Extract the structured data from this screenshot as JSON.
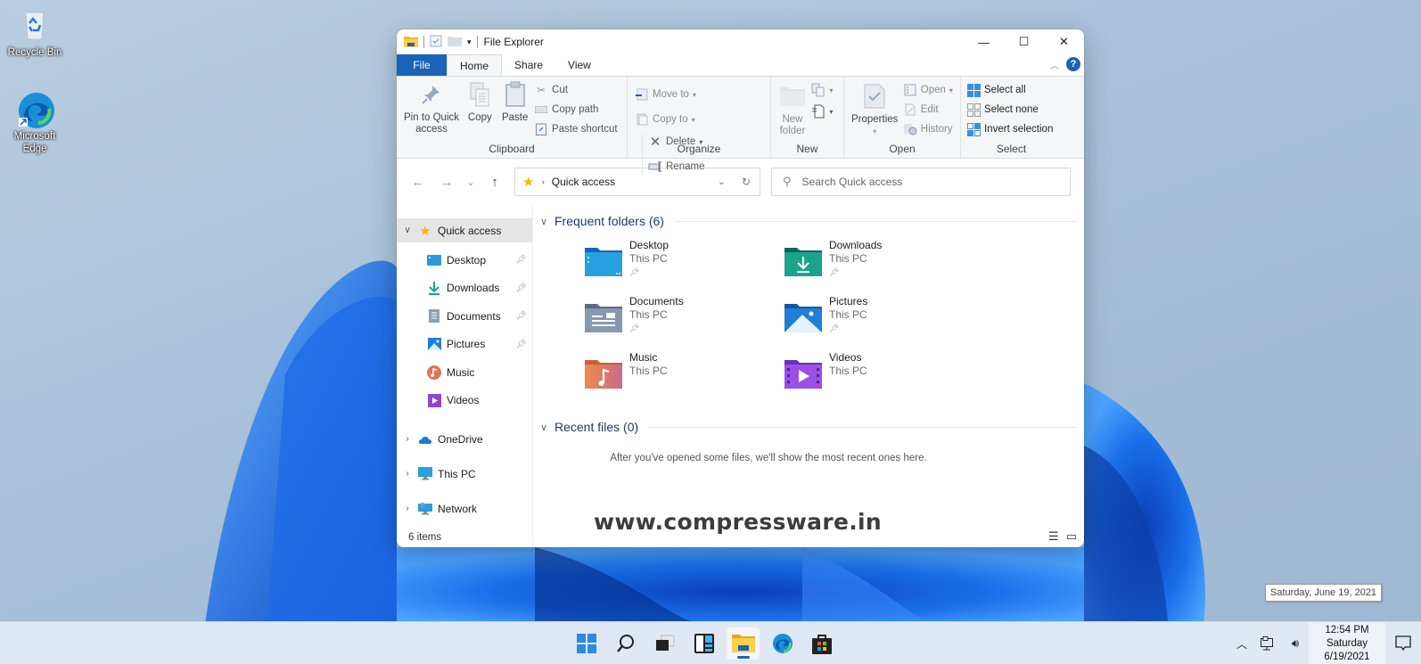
{
  "desktop": {
    "icons": [
      {
        "label": "Recycle Bin",
        "icon": "recycle-bin-icon"
      },
      {
        "label": "Microsoft Edge",
        "icon": "edge-icon"
      }
    ]
  },
  "window": {
    "title": "File Explorer",
    "controls": {
      "minimize": "—",
      "maximize": "☐",
      "close": "✕"
    }
  },
  "ribbon": {
    "tabs": [
      {
        "label": "File",
        "active": false
      },
      {
        "label": "Home",
        "active": true
      },
      {
        "label": "Share",
        "active": false
      },
      {
        "label": "View",
        "active": false
      }
    ],
    "help": "?",
    "collapse": "^",
    "groups": {
      "clipboard": {
        "label": "Clipboard",
        "pin": "Pin to Quick access",
        "pin_l1": "Pin to Quick",
        "pin_l2": "access",
        "copy": "Copy",
        "paste": "Paste",
        "cut": "Cut",
        "copy_path": "Copy path",
        "paste_shortcut": "Paste shortcut"
      },
      "organize": {
        "label": "Organize",
        "move_to": "Move to",
        "copy_to": "Copy to",
        "delete": "Delete",
        "rename": "Rename"
      },
      "new": {
        "label": "New",
        "new_folder_l1": "New",
        "new_folder_l2": "folder"
      },
      "open": {
        "label": "Open",
        "properties": "Properties",
        "open": "Open",
        "edit": "Edit",
        "history": "History"
      },
      "select": {
        "label": "Select",
        "select_all": "Select all",
        "select_none": "Select none",
        "invert": "Invert selection"
      }
    }
  },
  "navigation": {
    "back": "←",
    "forward": "→",
    "recent": "⌄",
    "up": "↑",
    "address": "Quick access",
    "search_placeholder": "Search Quick access"
  },
  "sidebar": {
    "items": [
      {
        "label": "Quick access",
        "selected": true
      },
      {
        "label": "Desktop",
        "pinned": true
      },
      {
        "label": "Downloads",
        "pinned": true
      },
      {
        "label": "Documents",
        "pinned": true
      },
      {
        "label": "Pictures",
        "pinned": true
      },
      {
        "label": "Music",
        "pinned": false
      },
      {
        "label": "Videos",
        "pinned": false
      },
      {
        "label": "OneDrive"
      },
      {
        "label": "This PC"
      },
      {
        "label": "Network"
      }
    ]
  },
  "content": {
    "frequent_header": "Frequent folders (6)",
    "folders": [
      {
        "name": "Desktop",
        "location": "This PC",
        "pinned": true
      },
      {
        "name": "Downloads",
        "location": "This PC",
        "pinned": true
      },
      {
        "name": "Documents",
        "location": "This PC",
        "pinned": true
      },
      {
        "name": "Pictures",
        "location": "This PC",
        "pinned": true
      },
      {
        "name": "Music",
        "location": "This PC",
        "pinned": false
      },
      {
        "name": "Videos",
        "location": "This PC",
        "pinned": false
      }
    ],
    "recent_header": "Recent files (0)",
    "recent_empty": "After you've opened some files, we'll show the most recent ones here."
  },
  "status": {
    "item_count": "6 items"
  },
  "watermark": "www.compressware.in",
  "taskbar": {
    "apps": [
      "start",
      "search",
      "task-view",
      "widgets",
      "file-explorer",
      "edge",
      "store"
    ],
    "active_app": "file-explorer",
    "clock": {
      "time": "12:54 PM",
      "day": "Saturday",
      "date": "6/19/2021"
    },
    "tooltip": "Saturday, June 19, 2021"
  }
}
